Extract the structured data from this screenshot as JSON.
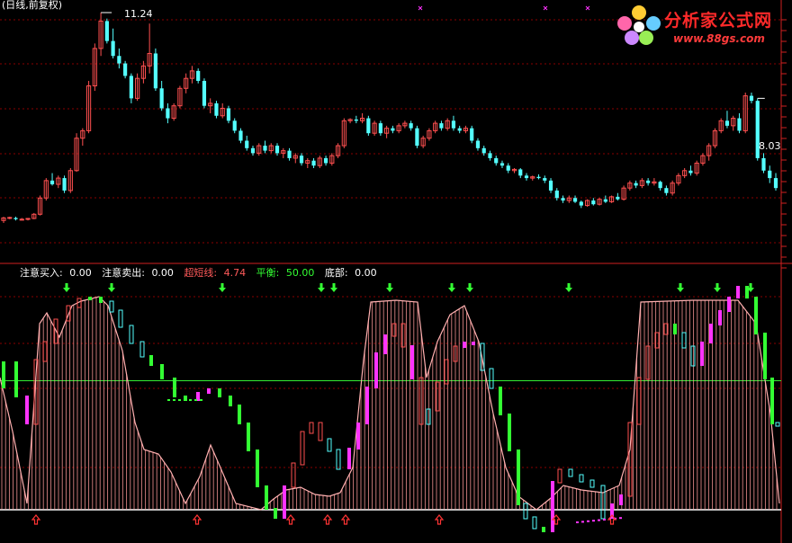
{
  "top_left_caption": "(日线,前复权)",
  "price_panel": {
    "high_label": "11.24",
    "last_label": "8.03"
  },
  "indicator_legend": [
    {
      "label": "注意买入:",
      "value": "0.00",
      "color": "#ffffff"
    },
    {
      "label": "注意卖出:",
      "value": "0.00",
      "color": "#ffffff"
    },
    {
      "label": "超短线:",
      "value": "4.74",
      "color": "#ff5a5a"
    },
    {
      "label": "平衡:",
      "value": "50.00",
      "color": "#33ff33"
    },
    {
      "label": "底部:",
      "value": "0.00",
      "color": "#ffffff"
    }
  ],
  "logo": {
    "title": "分析家公式网",
    "url": "www.88gs.com"
  },
  "colors": {
    "up": "#ff5050",
    "down": "#54ffff",
    "grid": "#8a0000",
    "balance_line": "#33ee33",
    "magenta": "#ff33ff",
    "green_bar": "#33ff33",
    "buy_arrow": "#ff3333",
    "sell_arrow": "#33ff33"
  },
  "chart_data": {
    "type": "candlestick_with_indicator",
    "price_series": [
      [
        2.9,
        3.05,
        2.8,
        3.0
      ],
      [
        3.0,
        3.05,
        2.95,
        3.02
      ],
      [
        3.0,
        3.05,
        2.9,
        2.95
      ],
      [
        2.95,
        3.0,
        2.9,
        2.95
      ],
      [
        2.95,
        3.0,
        2.9,
        2.98
      ],
      [
        2.98,
        3.2,
        2.95,
        3.15
      ],
      [
        3.15,
        3.9,
        3.1,
        3.8
      ],
      [
        3.8,
        4.6,
        3.7,
        4.5
      ],
      [
        4.5,
        4.8,
        4.3,
        4.35
      ],
      [
        4.35,
        4.7,
        4.2,
        4.6
      ],
      [
        4.6,
        4.7,
        4.0,
        4.1
      ],
      [
        4.1,
        5.0,
        4.0,
        4.9
      ],
      [
        4.9,
        6.4,
        4.85,
        6.2
      ],
      [
        6.2,
        6.6,
        5.9,
        6.5
      ],
      [
        6.5,
        8.5,
        6.4,
        8.3
      ],
      [
        8.3,
        10.0,
        8.1,
        9.8
      ],
      [
        9.8,
        11.24,
        9.5,
        10.9
      ],
      [
        10.9,
        11.0,
        10.0,
        10.1
      ],
      [
        10.1,
        10.6,
        9.4,
        9.5
      ],
      [
        9.5,
        9.8,
        9.0,
        9.2
      ],
      [
        9.2,
        9.3,
        8.6,
        8.7
      ],
      [
        8.7,
        8.8,
        7.6,
        7.8
      ],
      [
        7.8,
        8.8,
        7.7,
        8.6
      ],
      [
        8.6,
        9.3,
        8.4,
        9.1
      ],
      [
        9.1,
        10.8,
        8.8,
        9.6
      ],
      [
        9.6,
        9.8,
        8.1,
        8.2
      ],
      [
        8.2,
        8.5,
        7.3,
        7.4
      ],
      [
        7.4,
        7.6,
        6.8,
        7.0
      ],
      [
        7.0,
        7.6,
        6.9,
        7.5
      ],
      [
        7.5,
        8.3,
        7.4,
        8.2
      ],
      [
        8.2,
        8.8,
        8.0,
        8.6
      ],
      [
        8.6,
        9.1,
        8.4,
        8.9
      ],
      [
        8.9,
        9.0,
        8.4,
        8.5
      ],
      [
        8.5,
        8.6,
        7.4,
        7.5
      ],
      [
        7.5,
        7.8,
        7.2,
        7.6
      ],
      [
        7.6,
        7.7,
        7.0,
        7.1
      ],
      [
        7.1,
        7.6,
        7.0,
        7.4
      ],
      [
        7.4,
        7.5,
        6.8,
        6.9
      ],
      [
        6.9,
        7.0,
        6.4,
        6.5
      ],
      [
        6.5,
        6.6,
        6.0,
        6.1
      ],
      [
        6.1,
        6.3,
        5.7,
        5.8
      ],
      [
        5.8,
        5.9,
        5.5,
        5.6
      ],
      [
        5.6,
        6.0,
        5.5,
        5.9
      ],
      [
        5.9,
        6.1,
        5.6,
        5.7
      ],
      [
        5.7,
        6.0,
        5.6,
        5.9
      ],
      [
        5.9,
        6.0,
        5.5,
        5.6
      ],
      [
        5.6,
        5.8,
        5.4,
        5.7
      ],
      [
        5.7,
        5.8,
        5.3,
        5.4
      ],
      [
        5.4,
        5.6,
        5.2,
        5.5
      ],
      [
        5.5,
        5.6,
        5.1,
        5.2
      ],
      [
        5.2,
        5.4,
        5.0,
        5.3
      ],
      [
        5.3,
        5.4,
        5.0,
        5.1
      ],
      [
        5.1,
        5.5,
        5.0,
        5.4
      ],
      [
        5.4,
        5.5,
        5.1,
        5.2
      ],
      [
        5.2,
        5.6,
        5.1,
        5.5
      ],
      [
        5.5,
        6.0,
        5.4,
        5.9
      ],
      [
        5.9,
        7.0,
        5.8,
        6.9
      ],
      [
        6.9,
        7.0,
        6.8,
        6.95
      ],
      [
        6.95,
        7.1,
        6.8,
        6.9
      ],
      [
        6.9,
        7.2,
        6.8,
        7.0
      ],
      [
        7.0,
        7.1,
        6.3,
        6.4
      ],
      [
        6.4,
        6.9,
        6.3,
        6.8
      ],
      [
        6.8,
        6.9,
        6.3,
        6.4
      ],
      [
        6.4,
        6.7,
        6.2,
        6.6
      ],
      [
        6.6,
        6.7,
        6.4,
        6.5
      ],
      [
        6.5,
        6.8,
        6.4,
        6.7
      ],
      [
        6.7,
        6.9,
        6.6,
        6.8
      ],
      [
        6.8,
        6.9,
        6.5,
        6.6
      ],
      [
        6.6,
        6.7,
        5.8,
        5.9
      ],
      [
        5.9,
        6.3,
        5.8,
        6.2
      ],
      [
        6.2,
        6.6,
        6.1,
        6.5
      ],
      [
        6.5,
        6.9,
        6.4,
        6.8
      ],
      [
        6.8,
        6.9,
        6.5,
        6.6
      ],
      [
        6.6,
        7.0,
        6.5,
        6.9
      ],
      [
        6.9,
        7.1,
        6.5,
        6.6
      ],
      [
        6.6,
        6.7,
        6.4,
        6.5
      ],
      [
        6.5,
        6.7,
        6.4,
        6.6
      ],
      [
        6.6,
        6.7,
        6.0,
        6.1
      ],
      [
        6.1,
        6.2,
        5.7,
        5.8
      ],
      [
        5.8,
        5.9,
        5.5,
        5.6
      ],
      [
        5.6,
        5.7,
        5.3,
        5.4
      ],
      [
        5.4,
        5.5,
        5.1,
        5.2
      ],
      [
        5.2,
        5.3,
        5.0,
        5.1
      ],
      [
        5.1,
        5.2,
        4.8,
        4.9
      ],
      [
        4.9,
        5.0,
        4.8,
        4.95
      ],
      [
        4.95,
        5.0,
        4.6,
        4.7
      ],
      [
        4.7,
        4.8,
        4.5,
        4.6
      ],
      [
        4.6,
        4.7,
        4.5,
        4.65
      ],
      [
        4.65,
        4.75,
        4.55,
        4.6
      ],
      [
        4.6,
        4.7,
        4.4,
        4.5
      ],
      [
        4.5,
        4.6,
        4.0,
        4.1
      ],
      [
        4.1,
        4.2,
        3.7,
        3.8
      ],
      [
        3.8,
        3.9,
        3.6,
        3.7
      ],
      [
        3.7,
        3.9,
        3.6,
        3.8
      ],
      [
        3.8,
        3.9,
        3.6,
        3.65
      ],
      [
        3.65,
        3.7,
        3.4,
        3.5
      ],
      [
        3.5,
        3.75,
        3.45,
        3.7
      ],
      [
        3.7,
        3.8,
        3.5,
        3.55
      ],
      [
        3.55,
        3.8,
        3.5,
        3.75
      ],
      [
        3.75,
        3.9,
        3.6,
        3.65
      ],
      [
        3.65,
        3.9,
        3.6,
        3.85
      ],
      [
        3.85,
        4.0,
        3.7,
        3.75
      ],
      [
        3.75,
        4.3,
        3.7,
        4.2
      ],
      [
        4.2,
        4.5,
        4.1,
        4.4
      ],
      [
        4.4,
        4.5,
        4.2,
        4.3
      ],
      [
        4.3,
        4.6,
        4.2,
        4.5
      ],
      [
        4.5,
        4.6,
        4.3,
        4.4
      ],
      [
        4.4,
        4.6,
        4.3,
        4.45
      ],
      [
        4.45,
        4.5,
        4.1,
        4.2
      ],
      [
        4.2,
        4.3,
        3.9,
        4.0
      ],
      [
        4.0,
        4.5,
        3.9,
        4.4
      ],
      [
        4.4,
        4.8,
        4.3,
        4.7
      ],
      [
        4.7,
        5.0,
        4.6,
        4.9
      ],
      [
        4.9,
        5.1,
        4.7,
        4.8
      ],
      [
        4.8,
        5.3,
        4.7,
        5.2
      ],
      [
        5.2,
        5.6,
        5.1,
        5.5
      ],
      [
        5.5,
        6.0,
        5.3,
        5.9
      ],
      [
        5.9,
        6.6,
        5.8,
        6.5
      ],
      [
        6.5,
        7.0,
        6.4,
        6.9
      ],
      [
        6.9,
        7.3,
        6.6,
        6.7
      ],
      [
        6.7,
        7.1,
        6.5,
        7.0
      ],
      [
        7.0,
        7.2,
        6.4,
        6.5
      ],
      [
        6.5,
        8.03,
        6.4,
        7.9
      ],
      [
        7.9,
        8.03,
        7.6,
        7.7
      ],
      [
        7.7,
        7.8,
        5.3,
        5.4
      ],
      [
        5.4,
        5.6,
        4.8,
        4.9
      ],
      [
        4.9,
        5.1,
        4.4,
        4.6
      ],
      [
        4.6,
        4.8,
        4.1,
        4.2
      ]
    ],
    "indicator": {
      "balance_level": 50,
      "range": [
        0,
        100
      ]
    }
  }
}
